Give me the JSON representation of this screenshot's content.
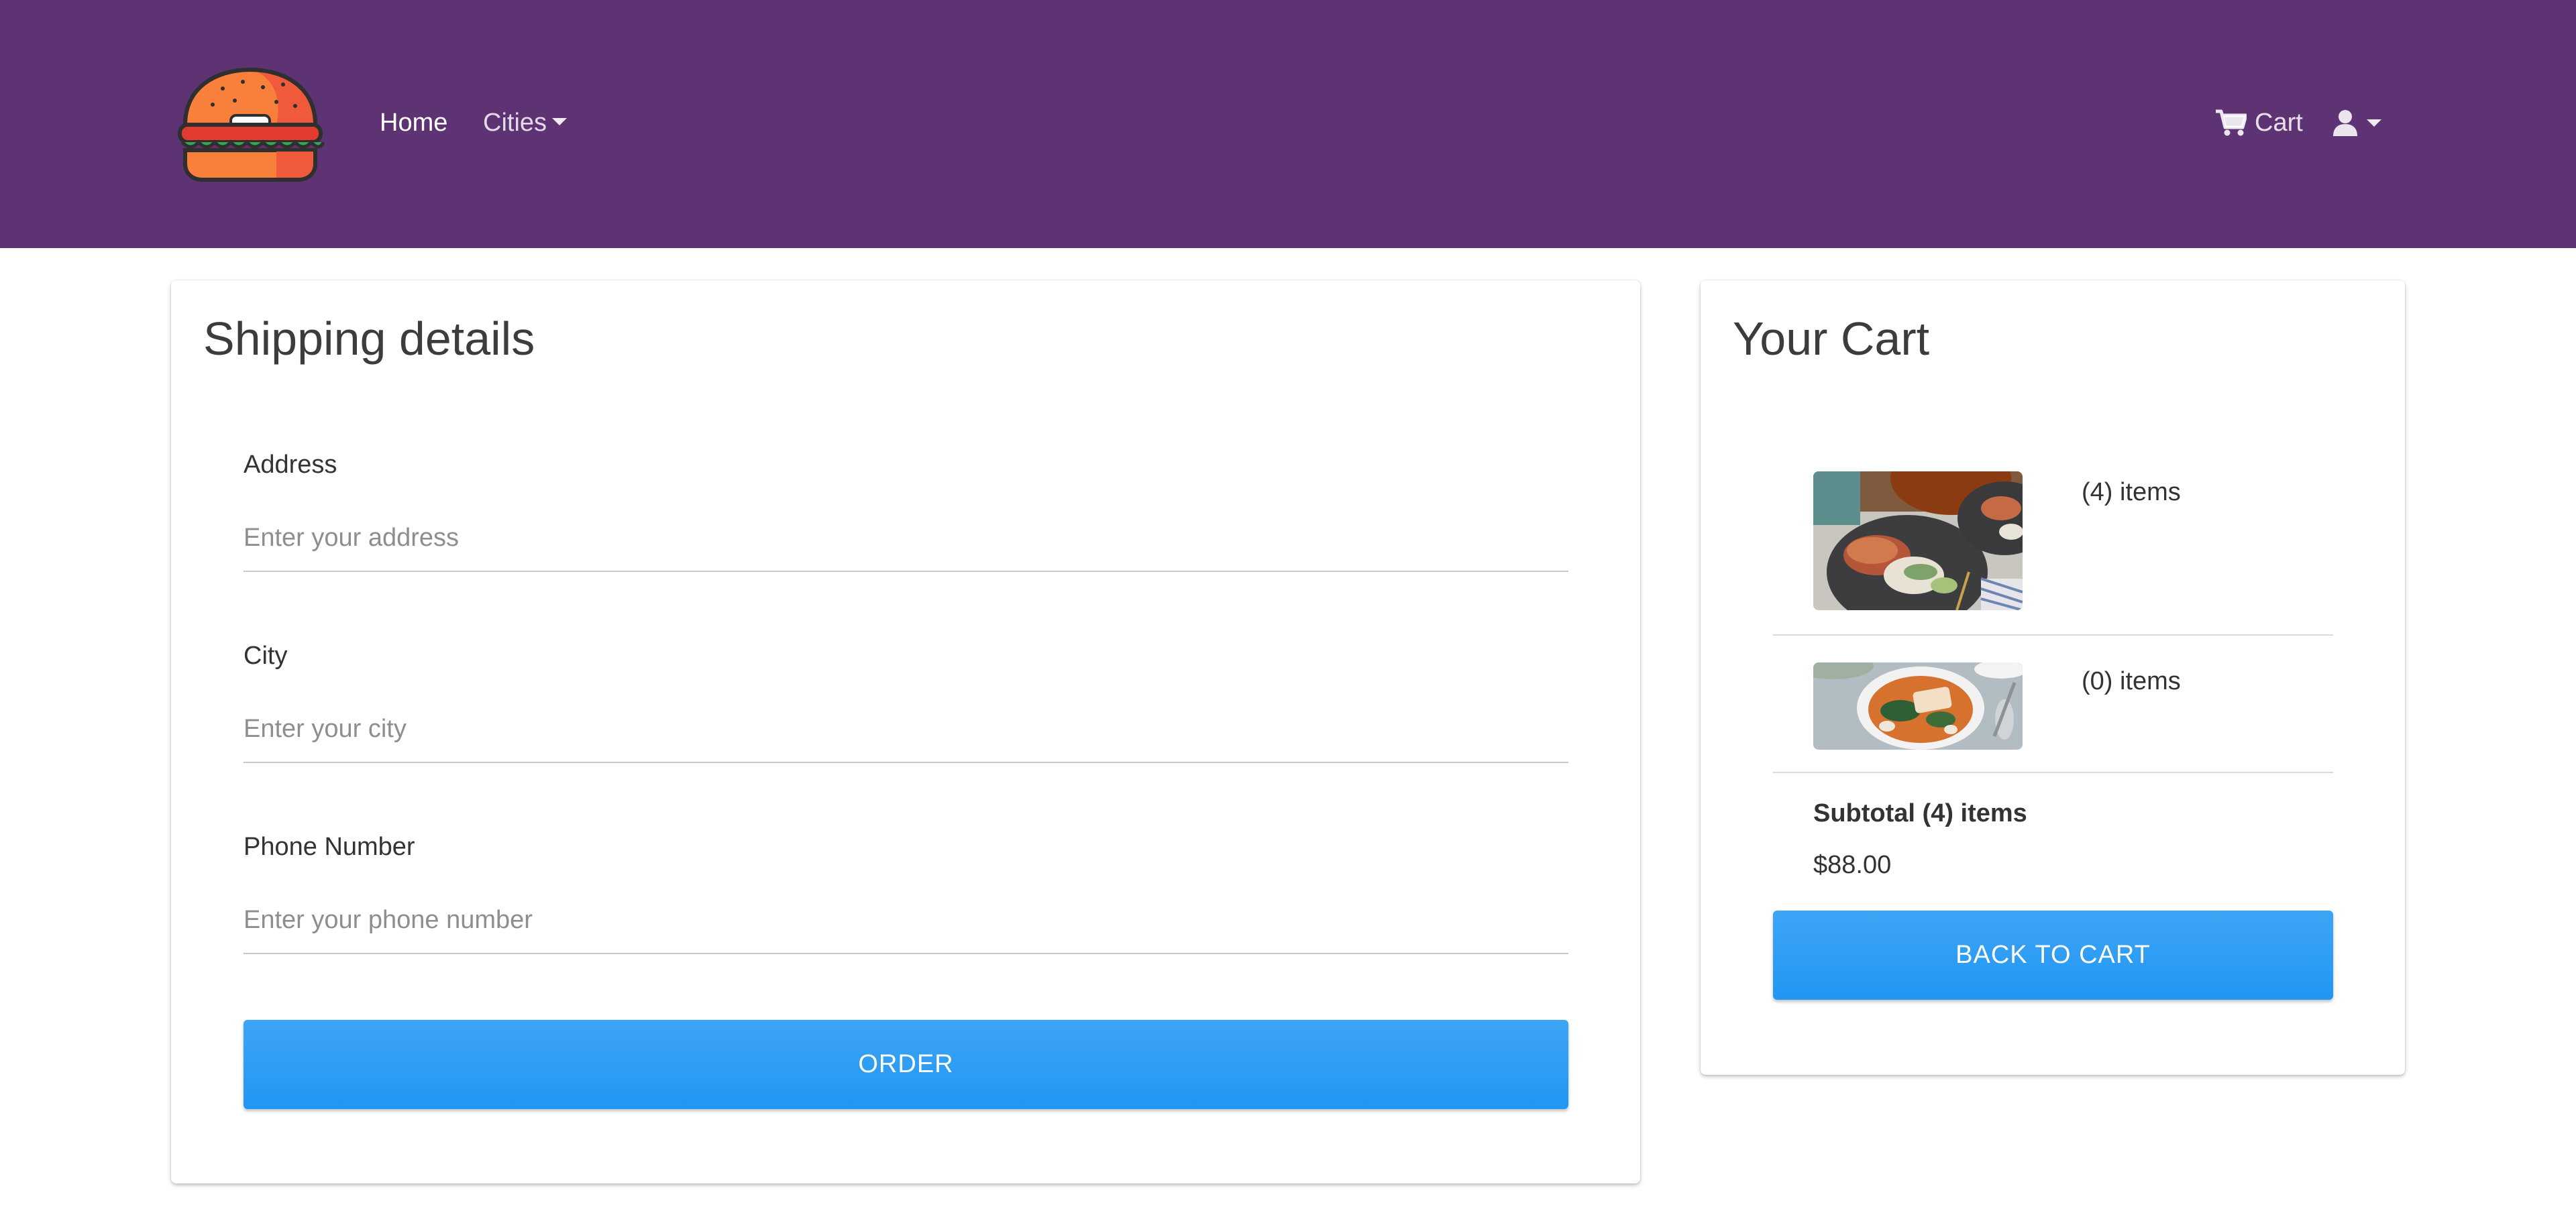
{
  "navbar": {
    "background": "#5d3373",
    "logo_icon": "burger-icon",
    "home_label": "Home",
    "cities_label": "Cities",
    "cart_label": "Cart",
    "cart_icon": "cart-icon",
    "user_icon": "user-icon"
  },
  "shipping": {
    "title": "Shipping details",
    "address": {
      "label": "Address",
      "value": "",
      "placeholder": "Enter your address"
    },
    "city": {
      "label": "City",
      "value": "",
      "placeholder": "Enter your city"
    },
    "phone": {
      "label": "Phone Number",
      "value": "",
      "placeholder": "Enter your phone number"
    },
    "order_button": "ORDER"
  },
  "cart": {
    "title": "Your Cart",
    "items": [
      {
        "count_text": "(4) items",
        "image": "salmon-plate-photo"
      },
      {
        "count_text": "(0) items",
        "image": "fish-stew-bowl-photo"
      }
    ],
    "subtotal_label": "Subtotal (4) items",
    "subtotal_value": "$88.00",
    "back_button": "BACK TO CART"
  },
  "colors": {
    "accent": "#2196f3",
    "navbar": "#5d3373"
  }
}
